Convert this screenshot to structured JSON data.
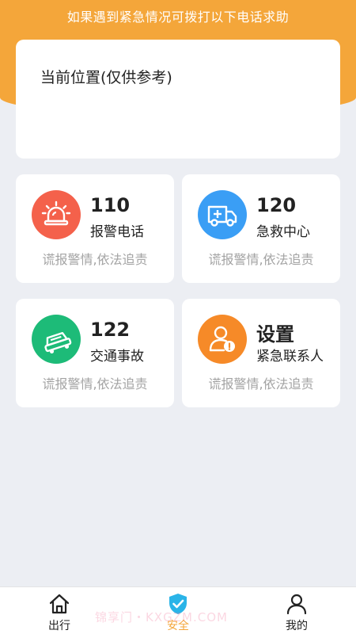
{
  "banner": {
    "text": "如果遇到紧急情况可拨打以下电话求助"
  },
  "location": {
    "label": "当前位置(仅供参考)"
  },
  "cards": [
    {
      "number": "110",
      "title": "报警电话",
      "note": "谎报警情,依法追责",
      "icon": "police-siren-icon",
      "color": "#f4614b"
    },
    {
      "number": "120",
      "title": "急救中心",
      "note": "谎报警情,依法追责",
      "icon": "ambulance-icon",
      "color": "#3a9ef5"
    },
    {
      "number": "122",
      "title": "交通事故",
      "note": "谎报警情,依法追责",
      "icon": "car-accident-icon",
      "color": "#1dbb78"
    },
    {
      "number": "设置",
      "title": "紧急联系人",
      "note": "谎报警情,依法追责",
      "icon": "emergency-contact-icon",
      "color": "#f68a28"
    }
  ],
  "nav": [
    {
      "label": "出行",
      "icon": "home-icon"
    },
    {
      "label": "安全",
      "icon": "shield-check-icon",
      "active": true
    },
    {
      "label": "我的",
      "icon": "person-icon"
    }
  ],
  "colors": {
    "accent": "#f4a63a",
    "background": "#eceef3"
  },
  "watermark": "锦享门・KXGZM.COM"
}
